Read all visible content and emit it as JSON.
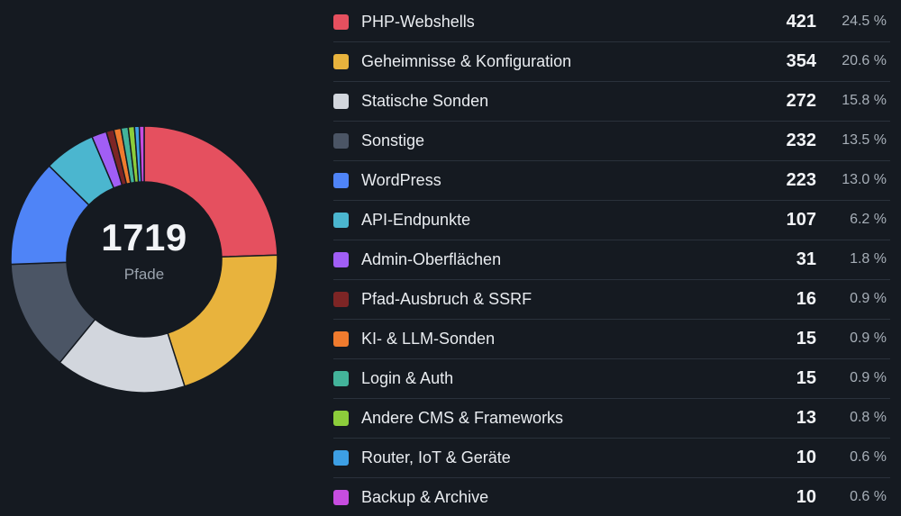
{
  "chart_data": {
    "type": "pie",
    "total": "1719",
    "total_label": "Pfade",
    "slices": [
      {
        "label": "PHP-Webshells",
        "value": 421,
        "percent": "24.5 %",
        "color": "#e5505f"
      },
      {
        "label": "Geheimnisse & Konfiguration",
        "value": 354,
        "percent": "20.6 %",
        "color": "#e8b33d"
      },
      {
        "label": "Statische Sonden",
        "value": 272,
        "percent": "15.8 %",
        "color": "#d2d6dd"
      },
      {
        "label": "Sonstige",
        "value": 232,
        "percent": "13.5 %",
        "color": "#4b5565"
      },
      {
        "label": "WordPress",
        "value": 223,
        "percent": "13.0 %",
        "color": "#4f84f7"
      },
      {
        "label": "API-Endpunkte",
        "value": 107,
        "percent": "6.2 %",
        "color": "#4bb6cf"
      },
      {
        "label": "Admin-Oberflächen",
        "value": 31,
        "percent": "1.8 %",
        "color": "#a15ef5"
      },
      {
        "label": "Pfad-Ausbruch & SSRF",
        "value": 16,
        "percent": "0.9 %",
        "color": "#7d2525"
      },
      {
        "label": "KI- & LLM-Sonden",
        "value": 15,
        "percent": "0.9 %",
        "color": "#ef7b2e"
      },
      {
        "label": "Login & Auth",
        "value": 15,
        "percent": "0.9 %",
        "color": "#43b39a"
      },
      {
        "label": "Andere CMS & Frameworks",
        "value": 13,
        "percent": "0.8 %",
        "color": "#8ccd3b"
      },
      {
        "label": "Router, IoT & Geräte",
        "value": 10,
        "percent": "0.6 %",
        "color": "#3d9fe4"
      },
      {
        "label": "Backup & Archive",
        "value": 10,
        "percent": "0.6 %",
        "color": "#c74de0"
      }
    ]
  }
}
